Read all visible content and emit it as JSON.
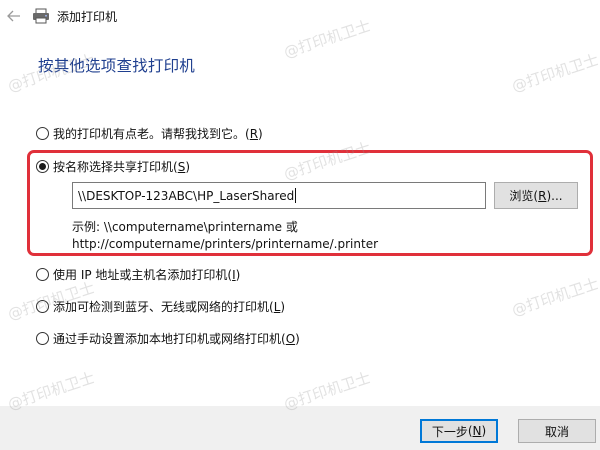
{
  "window": {
    "title": "添加打印机"
  },
  "heading": "按其他选项查找打印机",
  "options": [
    {
      "label": "我的打印机有点老。请帮我找到它。",
      "accel": "R",
      "checked": false
    },
    {
      "label": "按名称选择共享打印机",
      "accel": "S",
      "checked": true
    },
    {
      "label": "使用 IP 地址或主机名添加打印机",
      "accel": "I",
      "checked": false
    },
    {
      "label": "添加可检测到蓝牙、无线或网络的打印机",
      "accel": "L",
      "checked": false
    },
    {
      "label": "通过手动设置添加本地打印机或网络打印机",
      "accel": "O",
      "checked": false
    }
  ],
  "printer_name": {
    "value": "\\\\DESKTOP-123ABC\\HP_LaserShared"
  },
  "browse": {
    "label": "浏览",
    "accel": "R",
    "suffix": "..."
  },
  "example": {
    "line1": "示例: \\\\computername\\printername 或",
    "line2": "http://computername/printers/printername/.printer"
  },
  "buttons": {
    "next": {
      "label": "下一步",
      "accel": "N"
    },
    "cancel": "取消"
  },
  "watermark": "@打印机卫士",
  "colors": {
    "heading": "#1f3f8f",
    "highlight": "#e0303a",
    "default_button_border": "#0078d7"
  }
}
